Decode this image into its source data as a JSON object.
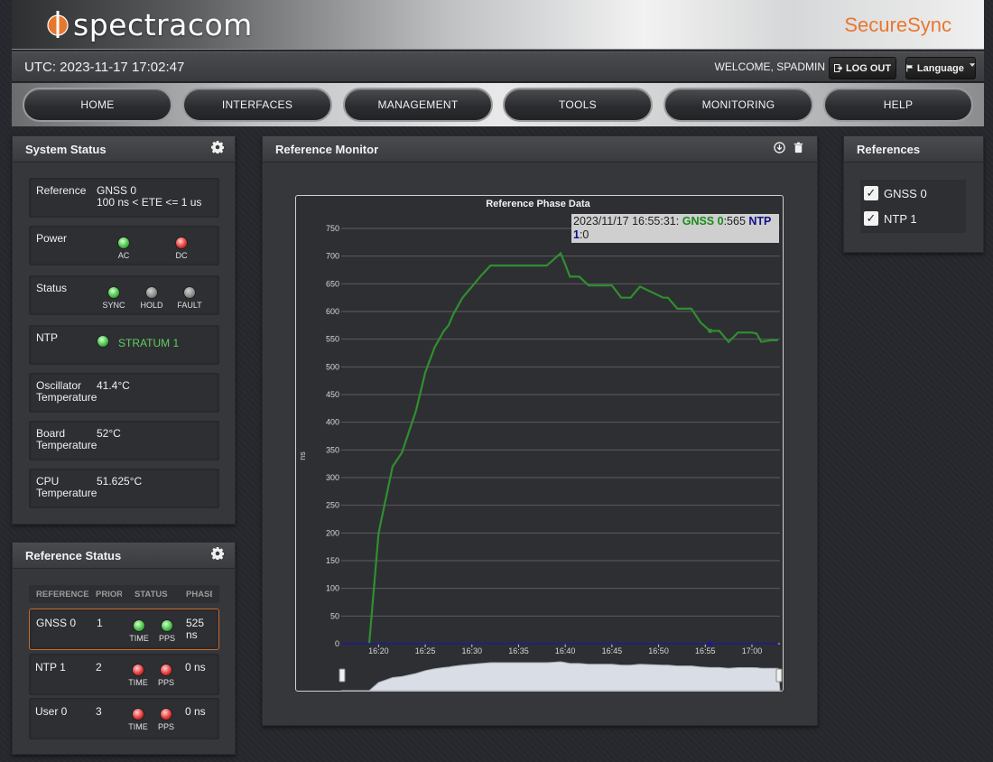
{
  "header": {
    "logo_text": "spectracom",
    "product": "SecureSync",
    "utc": "UTC: 2023-11-17 17:02:47",
    "welcome": "WELCOME, SPADMIN",
    "logout_label": "LOG OUT",
    "language_label": "Language"
  },
  "nav": [
    "HOME",
    "INTERFACES",
    "MANAGEMENT",
    "TOOLS",
    "MONITORING",
    "HELP"
  ],
  "system_status": {
    "title": "System Status",
    "reference": {
      "label": "Reference",
      "line1": "GNSS 0",
      "line2": "100 ns < ETE <= 1 us"
    },
    "power": {
      "label": "Power",
      "leds": [
        {
          "name": "AC",
          "color": "green"
        },
        {
          "name": "DC",
          "color": "red"
        }
      ]
    },
    "status": {
      "label": "Status",
      "leds": [
        {
          "name": "SYNC",
          "color": "green"
        },
        {
          "name": "HOLD",
          "color": "grey"
        },
        {
          "name": "FAULT",
          "color": "grey"
        }
      ]
    },
    "ntp": {
      "label": "NTP",
      "value": "STRATUM 1",
      "color": "green"
    },
    "osc": {
      "label1": "Oscillator",
      "label2": "Temperature",
      "value": "41.4°C"
    },
    "board": {
      "label1": "Board",
      "label2": "Temperature",
      "value": "52°C"
    },
    "cpu": {
      "label1": "CPU",
      "label2": "Temperature",
      "value": "51.625°C"
    }
  },
  "reference_status": {
    "title": "Reference Status",
    "headers": [
      "REFERENCE",
      "PRIORITY",
      "STATUS",
      "PHASE"
    ],
    "rows": [
      {
        "ref": "GNSS 0",
        "priority": "1",
        "time": "green",
        "pps": "green",
        "phase1": "525",
        "phase2": "ns"
      },
      {
        "ref": "NTP 1",
        "priority": "2",
        "time": "red",
        "pps": "red",
        "phase1": "0 ns",
        "phase2": ""
      },
      {
        "ref": "User 0",
        "priority": "3",
        "time": "red",
        "pps": "red",
        "phase1": "0 ns",
        "phase2": ""
      }
    ],
    "led_labels": [
      "TIME",
      "PPS"
    ]
  },
  "reference_monitor": {
    "title": "Reference Monitor",
    "tooltip": {
      "timestamp": "2023/11/17 16:55:31: ",
      "s0_name": "GNSS 0",
      "s0_value": ":565 ",
      "s1_name_a": "NTP",
      "s1_name_b": "1",
      "s1_value": ":0"
    }
  },
  "chart_data": {
    "type": "line",
    "title": "Reference Phase Data",
    "xlabel": "",
    "ylabel": "ns",
    "xlim": [
      "16:16",
      "17:03"
    ],
    "ylim": [
      0,
      750
    ],
    "yticks": [
      0,
      50,
      100,
      150,
      200,
      250,
      300,
      350,
      400,
      450,
      500,
      550,
      600,
      650,
      700,
      750
    ],
    "xticks": [
      "16:20",
      "16:25",
      "16:30",
      "16:35",
      "16:40",
      "16:45",
      "16:50",
      "16:55",
      "17:00"
    ],
    "grid": true,
    "series": [
      {
        "name": "GNSS 0",
        "color": "#2f8f2f",
        "x": [
          "16:19:00",
          "16:20:00",
          "16:21:30",
          "16:22:30",
          "16:24:00",
          "16:25:00",
          "16:26:00",
          "16:27:00",
          "16:27:30",
          "16:28:00",
          "16:29:00",
          "16:30:00",
          "16:31:00",
          "16:32:00",
          "16:33:00",
          "16:35:00",
          "16:38:00",
          "16:38:30",
          "16:39:30",
          "16:40:00",
          "16:40:30",
          "16:41:30",
          "16:42:30",
          "16:43:00",
          "16:45:00",
          "16:46:00",
          "16:47:00",
          "16:48:00",
          "16:50:30",
          "16:51:00",
          "16:52:00",
          "16:53:30",
          "16:54:30",
          "16:55:31",
          "16:56:30",
          "16:57:30",
          "16:58:30",
          "16:59:30",
          "17:00:00",
          "17:00:30",
          "17:01:00",
          "17:02:00",
          "17:02:47"
        ],
        "y": [
          0,
          200,
          320,
          345,
          420,
          490,
          535,
          565,
          575,
          595,
          625,
          645,
          665,
          683,
          683,
          683,
          683,
          690,
          705,
          685,
          663,
          663,
          647,
          647,
          647,
          625,
          625,
          645,
          625,
          625,
          605,
          605,
          580,
          565,
          565,
          545,
          562,
          562,
          562,
          560,
          545,
          548,
          548
        ]
      },
      {
        "name": "NTP 1",
        "color": "#1a1a9a",
        "x": [
          "16:16:00",
          "17:02:47"
        ],
        "y": [
          0,
          0
        ]
      }
    ]
  },
  "references": {
    "title": "References",
    "items": [
      {
        "label": "GNSS 0",
        "checked": true
      },
      {
        "label": "NTP 1",
        "checked": true
      }
    ]
  }
}
